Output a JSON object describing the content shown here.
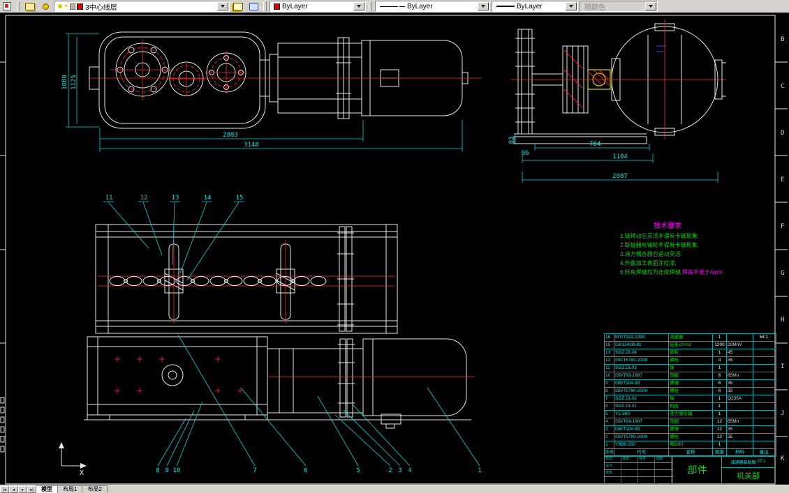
{
  "toolbar": {
    "layer_name": "3中心线层",
    "color": "ByLayer",
    "linetype": "ByLayer",
    "lineweight": "ByLayer",
    "plot_style": "随颜色"
  },
  "tabs": {
    "model": "模型",
    "layout1": "布局1",
    "layout2": "布局2"
  },
  "zones": [
    "B",
    "C",
    "D",
    "E",
    "F",
    "G",
    "H",
    "I",
    "J",
    "K"
  ],
  "ucs": {
    "x": "X"
  },
  "dims": {
    "v1080": "1080",
    "v1125": "1125",
    "h2883": "2883",
    "h3148": "3148",
    "v83": "83",
    "v96": "96",
    "h784": "784",
    "h1104": "1104",
    "h2087": "2087"
  },
  "callouts": {
    "mid": [
      "11",
      "12",
      "13",
      "14",
      "15"
    ],
    "bottom": [
      "8",
      "9",
      "10",
      "7",
      "6",
      "5",
      "2",
      "3",
      "4",
      "1"
    ]
  },
  "tech": {
    "title": "技术要求",
    "lines": [
      "1.链转动应灵活不得有卡链现象;",
      "2.联轴器与链轮不得有卡链现象;",
      "3.液力偶合器应运动灵活;",
      "4.外露加工表面涂红漆;"
    ],
    "line5_green": "6.所有焊缝均为连续焊缝,",
    "line5_magenta": "焊高不低于4mm."
  },
  "table": {
    "headers": [
      "序号",
      "代号",
      "名称",
      "数量",
      "材料",
      "备注"
    ],
    "rows": [
      {
        "no": "16",
        "code": "MT/T323-1990",
        "name": "减速器",
        "qty": "1",
        "mat": "",
        "note": "54:1"
      },
      {
        "no": "15",
        "code": "GB1243B-91",
        "name": "链条22×92",
        "qty": "1200",
        "mat": "20MnV",
        "note": ""
      },
      {
        "no": "13",
        "code": "SGZ.DL04",
        "name": "链轮",
        "qty": "1",
        "mat": "45",
        "note": ""
      },
      {
        "no": "12",
        "code": "GB/T5780-2000",
        "name": "螺栓",
        "qty": "4",
        "mat": "35",
        "note": ""
      },
      {
        "no": "11",
        "code": "SGZ.DL03",
        "name": "轴",
        "qty": "1",
        "mat": "",
        "note": ""
      },
      {
        "no": "10",
        "code": "GB/T93-1987",
        "name": "垫圈",
        "qty": "6",
        "mat": "65Mn",
        "note": ""
      },
      {
        "no": "9",
        "code": "GB/T104-88",
        "name": "螺母",
        "qty": "6",
        "mat": "35",
        "note": ""
      },
      {
        "no": "8",
        "code": "GB/T5780-2000",
        "name": "螺栓",
        "qty": "6",
        "mat": "35",
        "note": ""
      },
      {
        "no": "7",
        "code": "SGZ.DL02",
        "name": "轴",
        "qty": "1",
        "mat": "Q235A",
        "note": ""
      },
      {
        "no": "6",
        "code": "SGZ.DL01",
        "name": "机架",
        "qty": "1",
        "mat": "",
        "note": ""
      },
      {
        "no": "5",
        "code": "YL-560",
        "name": "液力偶合器",
        "qty": "1",
        "mat": "",
        "note": ""
      },
      {
        "no": "4",
        "code": "GB/T93-1987",
        "name": "垫圈",
        "qty": "12",
        "mat": "65Mn",
        "note": ""
      },
      {
        "no": "3",
        "code": "GB/T104-88",
        "name": "螺母",
        "qty": "12",
        "mat": "35",
        "note": ""
      },
      {
        "no": "2",
        "code": "GB/T5780-2000",
        "name": "螺栓",
        "qty": "12",
        "mat": "35",
        "note": ""
      },
      {
        "no": "1",
        "code": "YB99-250",
        "name": "电动机",
        "qty": "1",
        "mat": "",
        "note": ""
      }
    ]
  },
  "titleblock": {
    "part": "部件",
    "doc_title": "减速器装配图",
    "doc_no": "07-1",
    "dept": "机关部",
    "labels": [
      "标记",
      "处数",
      "签名",
      "日期",
      "设计",
      "审核"
    ]
  }
}
